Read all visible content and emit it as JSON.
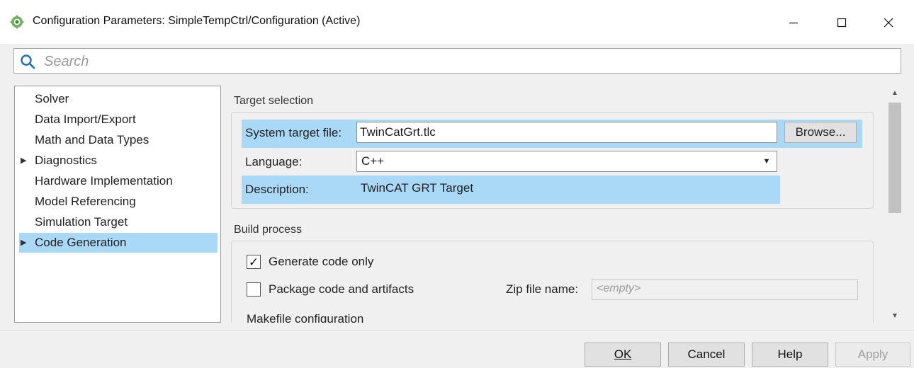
{
  "window": {
    "title": "Configuration Parameters: SimpleTempCtrl/Configuration (Active)",
    "minimize_glyph": "—",
    "maximize_glyph": "☐",
    "close_glyph": "✕"
  },
  "search": {
    "placeholder": "Search"
  },
  "tree": {
    "items": [
      {
        "label": "Solver",
        "expandable": false,
        "selected": false
      },
      {
        "label": "Data Import/Export",
        "expandable": false,
        "selected": false
      },
      {
        "label": "Math and Data Types",
        "expandable": false,
        "selected": false
      },
      {
        "label": "Diagnostics",
        "expandable": true,
        "selected": false
      },
      {
        "label": "Hardware Implementation",
        "expandable": false,
        "selected": false
      },
      {
        "label": "Model Referencing",
        "expandable": false,
        "selected": false
      },
      {
        "label": "Simulation Target",
        "expandable": false,
        "selected": false
      },
      {
        "label": "Code Generation",
        "expandable": true,
        "selected": true
      }
    ],
    "arrow_glyph": "▶"
  },
  "target_selection": {
    "title": "Target selection",
    "system_target_label": "System target file:",
    "system_target_value": "TwinCatGrt.tlc",
    "browse_label": "Browse...",
    "language_label": "Language:",
    "language_value": "C++",
    "description_label": "Description:",
    "description_value": "TwinCAT GRT Target"
  },
  "build_process": {
    "title": "Build process",
    "generate_code_only_label": "Generate code only",
    "generate_code_only_checked": true,
    "check_glyph": "✓",
    "package_label": "Package code and artifacts",
    "package_checked": false,
    "zip_label": "Zip file name:",
    "zip_placeholder": "<empty>",
    "makefile_label": "Makefile configuration"
  },
  "footer": {
    "ok": "OK",
    "cancel": "Cancel",
    "help": "Help",
    "apply": "Apply"
  },
  "colors": {
    "highlight": "#a9d9f7",
    "app_icon": "#5aa05a"
  }
}
